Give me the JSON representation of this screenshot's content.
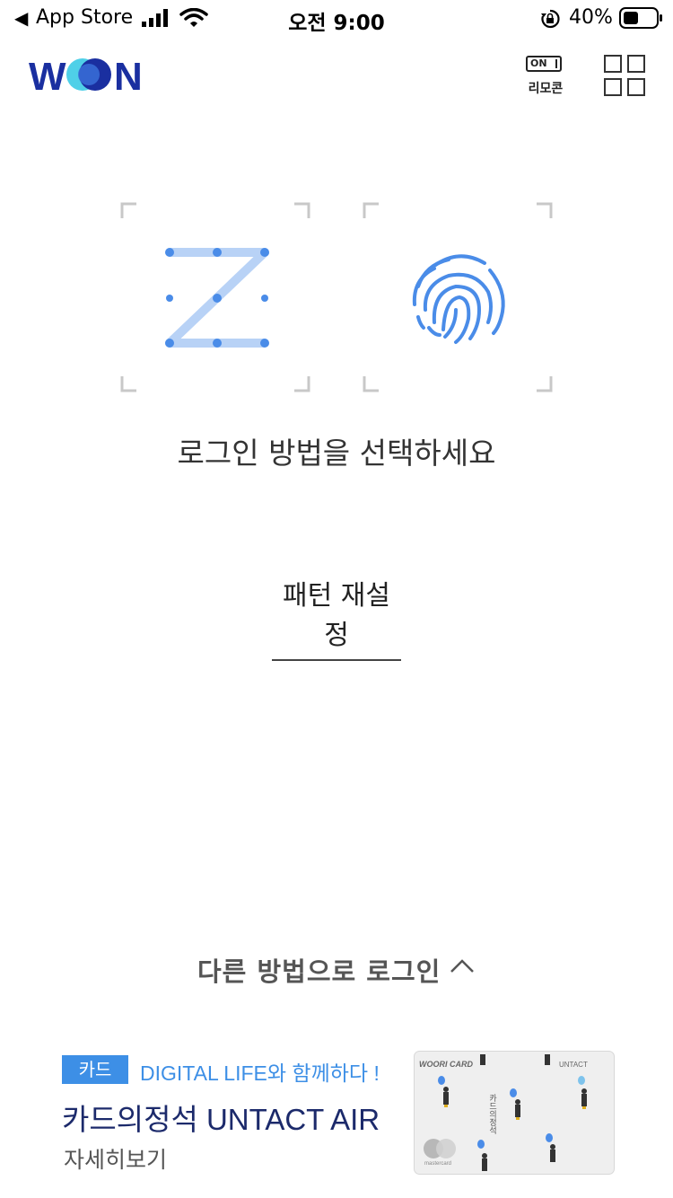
{
  "status_bar": {
    "back_label": "App Store",
    "time": "오전 9:00",
    "battery": "40%"
  },
  "header": {
    "logo_text": "WON",
    "remote_toggle": "ON",
    "remote_label": "리모콘"
  },
  "login": {
    "prompt": "로그인 방법을 선택하세요",
    "reset_pattern": "패턴 재설정",
    "other_methods": "다른 방법으로 로그인"
  },
  "promo": {
    "tag": "카드",
    "tagline": "DIGITAL LIFE와 함께하다 !",
    "title": "카드의정석 UNTACT AIR",
    "detail": "자세히보기",
    "card_brand": "WOORI CARD",
    "card_badge": "UNTACT",
    "card_name": "카드의정석",
    "card_network": "mastercard"
  },
  "colors": {
    "accent_blue": "#3d8fe6",
    "pattern_blue": "#4a8ce8",
    "brand_navy": "#1a2fa0"
  }
}
